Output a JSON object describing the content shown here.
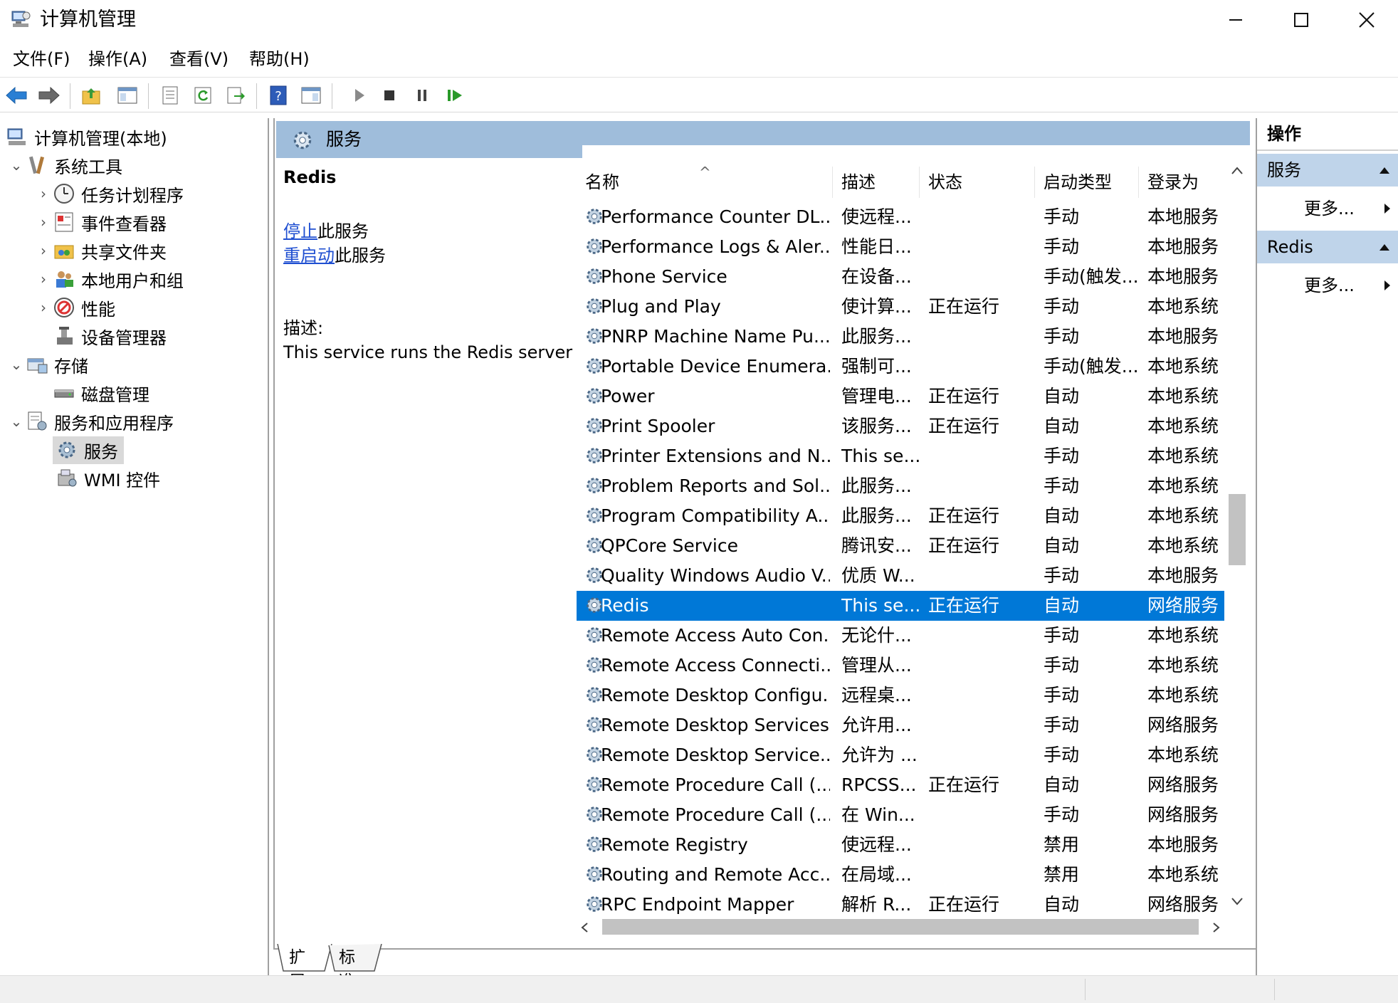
{
  "window": {
    "title": "计算机管理"
  },
  "menu": [
    "文件(F)",
    "操作(A)",
    "查看(V)",
    "帮助(H)"
  ],
  "tree": {
    "root": "计算机管理(本地)",
    "items": [
      {
        "label": "系统工具"
      },
      {
        "label": "任务计划程序"
      },
      {
        "label": "事件查看器"
      },
      {
        "label": "共享文件夹"
      },
      {
        "label": "本地用户和组"
      },
      {
        "label": "性能"
      },
      {
        "label": "设备管理器"
      },
      {
        "label": "存储"
      },
      {
        "label": "磁盘管理"
      },
      {
        "label": "服务和应用程序"
      },
      {
        "label": "服务"
      },
      {
        "label": "WMI 控件"
      }
    ]
  },
  "header": {
    "title": "服务"
  },
  "detail": {
    "service_name": "Redis",
    "stop_link": "停止",
    "stop_suffix": "此服务",
    "restart_link": "重启动",
    "restart_suffix": "此服务",
    "desc_label": "描述:",
    "desc_text": "This service runs the Redis server"
  },
  "columns": [
    "名称",
    "描述",
    "状态",
    "启动类型",
    "登录为"
  ],
  "rows": [
    {
      "name": "Performance Counter DL...",
      "desc": "使远程...",
      "status": "",
      "startup": "手动",
      "logon": "本地服务"
    },
    {
      "name": "Performance Logs & Aler...",
      "desc": "性能日...",
      "status": "",
      "startup": "手动",
      "logon": "本地服务"
    },
    {
      "name": "Phone Service",
      "desc": "在设备...",
      "status": "",
      "startup": "手动(触发...",
      "logon": "本地服务"
    },
    {
      "name": "Plug and Play",
      "desc": "使计算...",
      "status": "正在运行",
      "startup": "手动",
      "logon": "本地系统"
    },
    {
      "name": "PNRP Machine Name Pu...",
      "desc": "此服务...",
      "status": "",
      "startup": "手动",
      "logon": "本地服务"
    },
    {
      "name": "Portable Device Enumera...",
      "desc": "强制可...",
      "status": "",
      "startup": "手动(触发...",
      "logon": "本地系统"
    },
    {
      "name": "Power",
      "desc": "管理电...",
      "status": "正在运行",
      "startup": "自动",
      "logon": "本地系统"
    },
    {
      "name": "Print Spooler",
      "desc": "该服务...",
      "status": "正在运行",
      "startup": "自动",
      "logon": "本地系统"
    },
    {
      "name": "Printer Extensions and N...",
      "desc": "This se...",
      "status": "",
      "startup": "手动",
      "logon": "本地系统"
    },
    {
      "name": "Problem Reports and Sol...",
      "desc": "此服务...",
      "status": "",
      "startup": "手动",
      "logon": "本地系统"
    },
    {
      "name": "Program Compatibility A...",
      "desc": "此服务...",
      "status": "正在运行",
      "startup": "自动",
      "logon": "本地系统"
    },
    {
      "name": "QPCore Service",
      "desc": "腾讯安...",
      "status": "正在运行",
      "startup": "自动",
      "logon": "本地系统"
    },
    {
      "name": "Quality Windows Audio V...",
      "desc": "优质 W...",
      "status": "",
      "startup": "手动",
      "logon": "本地服务"
    },
    {
      "name": "Redis",
      "desc": "This se...",
      "status": "正在运行",
      "startup": "自动",
      "logon": "网络服务",
      "selected": true
    },
    {
      "name": "Remote Access Auto Con...",
      "desc": "无论什...",
      "status": "",
      "startup": "手动",
      "logon": "本地系统"
    },
    {
      "name": "Remote Access Connecti...",
      "desc": "管理从...",
      "status": "",
      "startup": "手动",
      "logon": "本地系统"
    },
    {
      "name": "Remote Desktop Configu...",
      "desc": "远程桌...",
      "status": "",
      "startup": "手动",
      "logon": "本地系统"
    },
    {
      "name": "Remote Desktop Services",
      "desc": "允许用...",
      "status": "",
      "startup": "手动",
      "logon": "网络服务"
    },
    {
      "name": "Remote Desktop Service...",
      "desc": "允许为 ...",
      "status": "",
      "startup": "手动",
      "logon": "本地系统"
    },
    {
      "name": "Remote Procedure Call (...",
      "desc": "RPCSS...",
      "status": "正在运行",
      "startup": "自动",
      "logon": "网络服务"
    },
    {
      "name": "Remote Procedure Call (...",
      "desc": "在 Win...",
      "status": "",
      "startup": "手动",
      "logon": "网络服务"
    },
    {
      "name": "Remote Registry",
      "desc": "使远程...",
      "status": "",
      "startup": "禁用",
      "logon": "本地服务"
    },
    {
      "name": "Routing and Remote Acc...",
      "desc": "在局域...",
      "status": "",
      "startup": "禁用",
      "logon": "本地系统"
    },
    {
      "name": "RPC Endpoint Mapper",
      "desc": "解析 R...",
      "status": "正在运行",
      "startup": "自动",
      "logon": "网络服务"
    }
  ],
  "tabs": [
    "扩展",
    "标准"
  ],
  "actions": {
    "title": "操作",
    "sections": [
      {
        "label": "服务",
        "more": "更多..."
      },
      {
        "label": "Redis",
        "more": "更多..."
      }
    ]
  },
  "colors": {
    "selected_row": "#0078d7",
    "header_band": "#9fbddb",
    "action_section": "#bfd4ea"
  }
}
